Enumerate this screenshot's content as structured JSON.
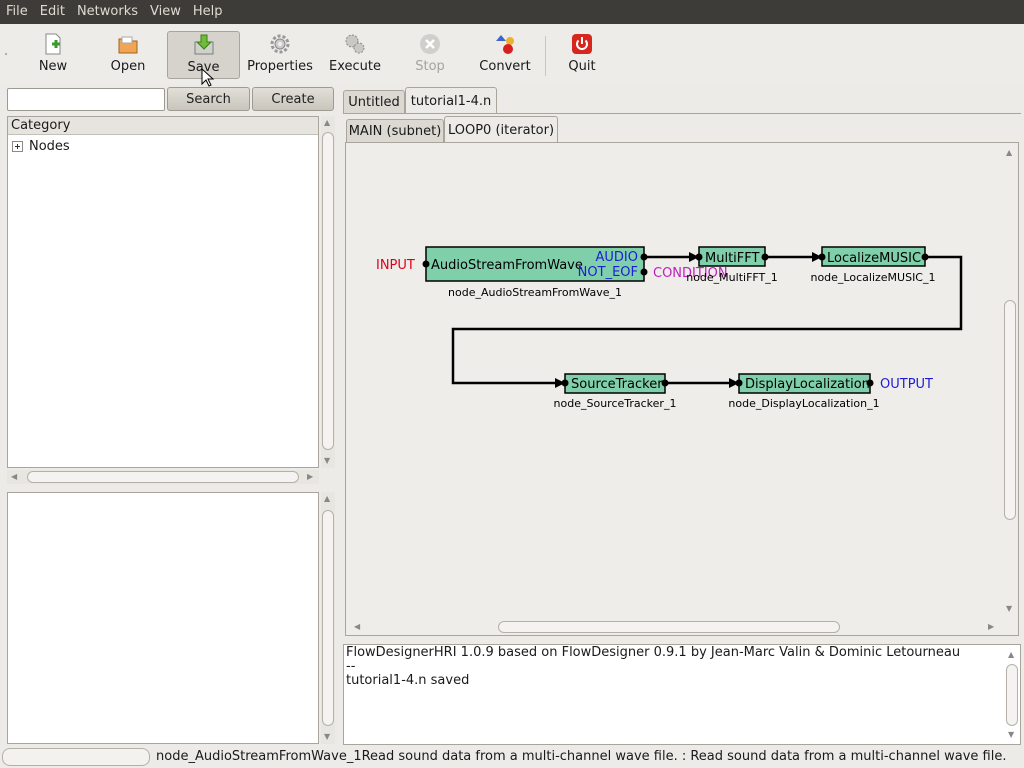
{
  "menubar": {
    "items": [
      "File",
      "Edit",
      "Networks",
      "View",
      "Help"
    ]
  },
  "toolbar": {
    "new": "New",
    "open": "Open",
    "save": "Save",
    "properties": "Properties",
    "execute": "Execute",
    "stop": "Stop",
    "convert": "Convert",
    "quit": "Quit"
  },
  "search": {
    "value": "",
    "search_label": "Search",
    "create_label": "Create"
  },
  "tree": {
    "header": "Category",
    "items": [
      "Nodes"
    ]
  },
  "doc_tabs": [
    "Untitled",
    "tutorial1-4.n"
  ],
  "sub_tabs": [
    "MAIN (subnet)",
    "LOOP0 (iterator)"
  ],
  "graph": {
    "input_label": "INPUT",
    "output_label": "OUTPUT",
    "condition_label": "CONDITION",
    "nodes": [
      {
        "title": "AudioStreamFromWave",
        "name": "node_AudioStreamFromWave_1",
        "outputs": [
          "AUDIO",
          "NOT_EOF"
        ]
      },
      {
        "title": "MultiFFT",
        "name": "node_MultiFFT_1"
      },
      {
        "title": "LocalizeMUSIC",
        "name": "node_LocalizeMUSIC_1"
      },
      {
        "title": "SourceTracker",
        "name": "node_SourceTracker_1"
      },
      {
        "title": "DisplayLocalization",
        "name": "node_DisplayLocalization_1"
      }
    ]
  },
  "log": {
    "lines": [
      "FlowDesignerHRI 1.0.9 based on FlowDesigner 0.9.1 by Jean-Marc Valin & Dominic Letourneau",
      "--",
      "tutorial1-4.n saved"
    ]
  },
  "status": {
    "text": "node_AudioStreamFromWave_1Read sound data from a multi-channel wave file. : Read sound data from a multi-channel wave file."
  },
  "colors": {
    "node_fill": "#7fcfaa",
    "input_label": "#e0001b",
    "port_label": "#1d1dd8",
    "condition_label": "#c020c0"
  }
}
